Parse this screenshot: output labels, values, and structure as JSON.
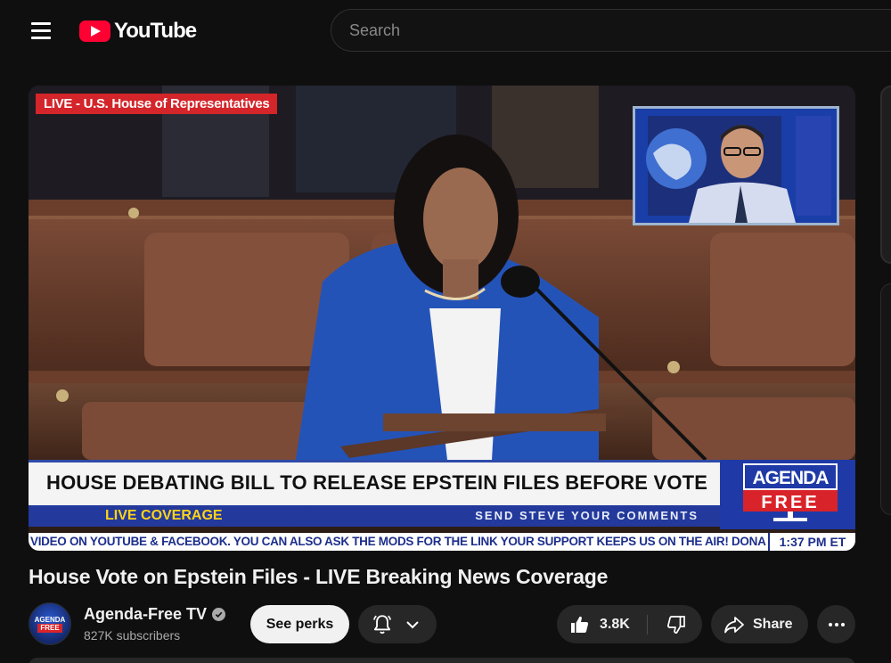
{
  "header": {
    "logo_text": "YouTube",
    "search_placeholder": "Search"
  },
  "video": {
    "live_tag": "LIVE - U.S. House of Representatives",
    "chyron_headline": "HOUSE DEBATING BILL TO RELEASE EPSTEIN FILES BEFORE VOTE",
    "chyron_live": "LIVE COVERAGE",
    "chyron_send": "SEND STEVE YOUR COMMENTS",
    "brand_top": "AGENDA",
    "brand_bottom": "FREE",
    "ticker_text": "VIDEO ON YOUTUBE & FACEBOOK. YOU CAN ALSO ASK THE MODS FOR THE LINK      YOUR SUPPORT KEEPS US ON THE AIR! DONA",
    "ticker_time": "1:37 PM ET"
  },
  "title": "House Vote on Epstein Files - LIVE Breaking News Coverage",
  "channel": {
    "name": "Agenda-Free TV",
    "subscribers": "827K subscribers",
    "avatar_top": "AGENDA",
    "avatar_bottom": "FREE"
  },
  "actions": {
    "perks_label": "See perks",
    "like_count": "3.8K",
    "share_label": "Share"
  },
  "colors": {
    "background": "#0f0f0f",
    "brand_red": "#ff0033",
    "chyron_blue": "#23399c",
    "button_bg": "#272727"
  }
}
